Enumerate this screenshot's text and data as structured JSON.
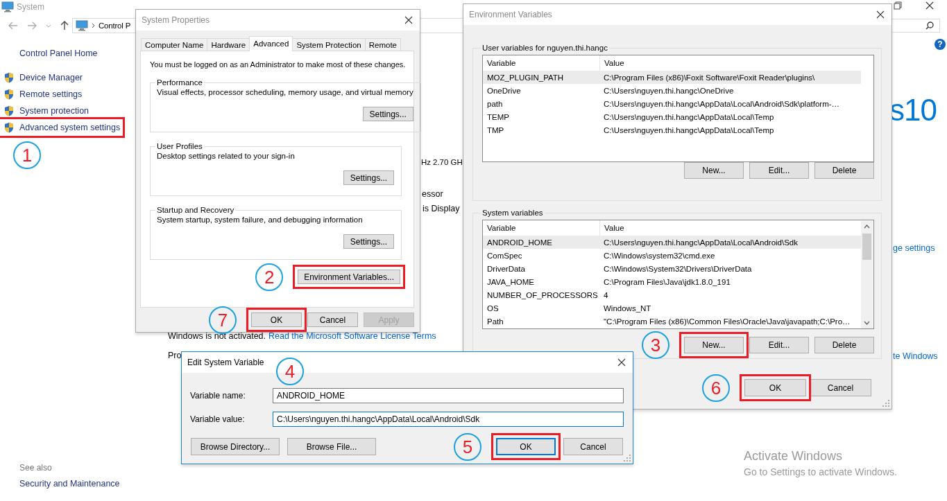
{
  "system_window": {
    "title": "System",
    "address": "Control P",
    "help": "?",
    "sidebar": {
      "home": "Control Panel Home",
      "items": [
        {
          "label": "Device Manager",
          "highlighted": false
        },
        {
          "label": "Remote settings",
          "highlighted": false
        },
        {
          "label": "System protection",
          "highlighted": false
        },
        {
          "label": "Advanced system settings",
          "highlighted": true,
          "step": "1"
        }
      ]
    },
    "see_also": {
      "heading": "See also",
      "items": [
        "Security and Maintenance"
      ]
    },
    "fragments": [
      {
        "kind": "logo",
        "text": "s10"
      },
      {
        "kind": "text",
        "text": "Hz"
      },
      {
        "kind": "text",
        "text": "2.70 GH"
      },
      {
        "kind": "text",
        "text": "essor"
      },
      {
        "kind": "text",
        "text": "is Display"
      },
      {
        "kind": "link",
        "text": "ge settings"
      },
      {
        "kind": "text",
        "text": "Windows is not activated."
      },
      {
        "kind": "link",
        "text": "Read the Microsoft Software License Terms"
      },
      {
        "kind": "text",
        "text": "Pro"
      },
      {
        "kind": "link",
        "text": "te Windows"
      }
    ]
  },
  "system_properties": {
    "title": "System Properties",
    "tabs": [
      {
        "label": "Computer Name",
        "selected": false
      },
      {
        "label": "Hardware",
        "selected": false
      },
      {
        "label": "Advanced",
        "selected": true
      },
      {
        "label": "System Protection",
        "selected": false
      },
      {
        "label": "Remote",
        "selected": false
      }
    ],
    "notice": "You must be logged on as an Administrator to make most of these changes.",
    "groups": [
      {
        "title": "Performance",
        "description": "Visual effects, processor scheduling, memory usage, and virtual memory",
        "button": "Settings..."
      },
      {
        "title": "User Profiles",
        "description": "Desktop settings related to your sign-in",
        "button": "Settings..."
      },
      {
        "title": "Startup and Recovery",
        "description": "System startup, system failure, and debugging information",
        "button": "Settings..."
      }
    ],
    "env_button": {
      "label": "Environment Variables...",
      "highlighted": true,
      "step": "2"
    },
    "buttons": [
      {
        "label": "OK",
        "disabled": false,
        "highlighted": true,
        "step": "7"
      },
      {
        "label": "Cancel",
        "disabled": false
      },
      {
        "label": "Apply",
        "disabled": true
      }
    ]
  },
  "environment_variables": {
    "title": "Environment Variables",
    "user_variables": {
      "title": "User variables for nguyen.thi.hangc",
      "columns": [
        "Variable",
        "Value"
      ],
      "rows": [
        {
          "variable": "MOZ_PLUGIN_PATH",
          "value": "C:\\Program Files (x86)\\Foxit Software\\Foxit Reader\\plugins\\",
          "selected": true
        },
        {
          "variable": "OneDrive",
          "value": "C:\\Users\\nguyen.thi.hangc\\OneDrive",
          "selected": false
        },
        {
          "variable": "path",
          "value": "C:\\Users\\nguyen.thi.hangc\\AppData\\Local\\Android\\Sdk\\platform-…",
          "selected": false
        },
        {
          "variable": "TEMP",
          "value": "C:\\Users\\nguyen.thi.hangc\\AppData\\Local\\Temp",
          "selected": false
        },
        {
          "variable": "TMP",
          "value": "C:\\Users\\nguyen.thi.hangc\\AppData\\Local\\Temp",
          "selected": false
        }
      ],
      "buttons": [
        {
          "label": "New..."
        },
        {
          "label": "Edit..."
        },
        {
          "label": "Delete"
        }
      ]
    },
    "system_variables": {
      "title": "System variables",
      "columns": [
        "Variable",
        "Value"
      ],
      "rows": [
        {
          "variable": "ANDROID_HOME",
          "value": "C:\\Users\\nguyen.thi.hangc\\AppData\\Local\\Android\\Sdk",
          "selected": true
        },
        {
          "variable": "ComSpec",
          "value": "C:\\Windows\\system32\\cmd.exe",
          "selected": false
        },
        {
          "variable": "DriverData",
          "value": "C:\\Windows\\System32\\Drivers\\DriverData",
          "selected": false
        },
        {
          "variable": "JAVA_HOME",
          "value": "C:\\Program Files\\Java\\jdk1.8.0_191",
          "selected": false
        },
        {
          "variable": "NUMBER_OF_PROCESSORS",
          "value": "4",
          "selected": false
        },
        {
          "variable": "OS",
          "value": "Windows_NT",
          "selected": false
        },
        {
          "variable": "Path",
          "value": "\"C:\\Program Files (x86)\\Common Files\\Oracle\\Java\\javapath;C:\\Pro…",
          "selected": false
        }
      ],
      "buttons": [
        {
          "label": "New...",
          "highlighted": true,
          "step": "3"
        },
        {
          "label": "Edit..."
        },
        {
          "label": "Delete"
        }
      ]
    },
    "buttons": [
      {
        "label": "OK",
        "highlighted": true,
        "step": "6"
      },
      {
        "label": "Cancel"
      }
    ]
  },
  "edit_variable": {
    "title": "Edit System Variable",
    "step": "4",
    "fields": [
      {
        "label": "Variable name:",
        "value": "ANDROID_HOME",
        "focused": false
      },
      {
        "label": "Variable value:",
        "value": "C:\\Users\\nguyen.thi.hangc\\AppData\\Local\\Android\\Sdk",
        "focused": true
      }
    ],
    "browse_buttons": [
      {
        "label": "Browse Directory..."
      },
      {
        "label": "Browse File..."
      }
    ],
    "buttons": [
      {
        "label": "OK",
        "default": true,
        "highlighted": true,
        "step": "5"
      },
      {
        "label": "Cancel",
        "default": false
      }
    ]
  },
  "activation_notice": {
    "title": "Activate Windows",
    "text": "Go to Settings to activate Windows."
  }
}
